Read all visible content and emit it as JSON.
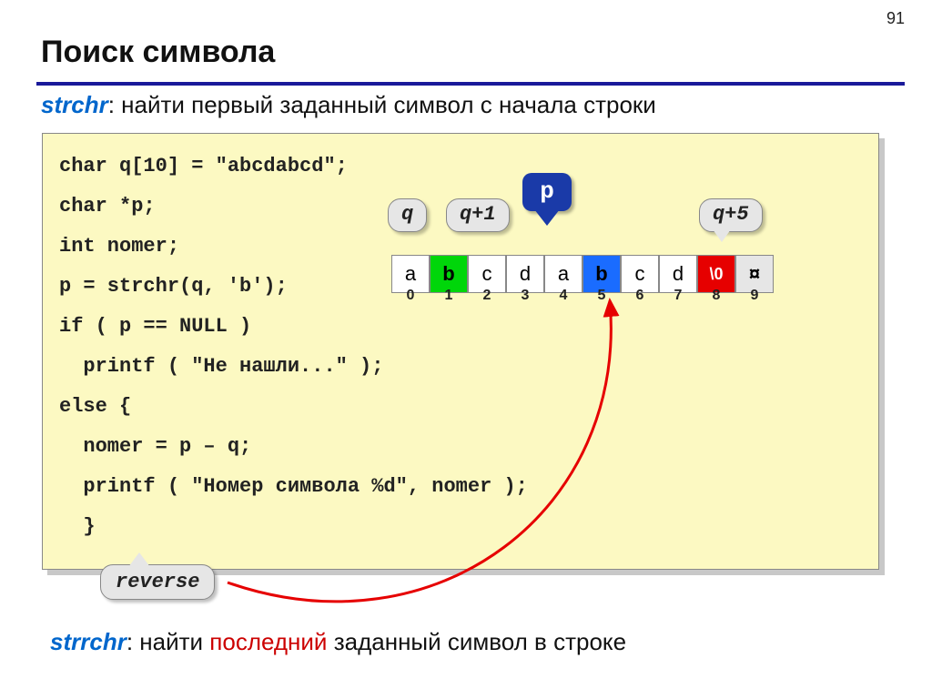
{
  "page_number": "91",
  "title": "Поиск символа",
  "subtitle": {
    "fn": "strchr",
    "rest": ": найти первый заданный символ c начала строки"
  },
  "code": {
    "l1": "char q[10] = \"abcdabcd\";",
    "l2": "char *p;",
    "l3": "int nomer;",
    "l4": "p = strchr(q, 'b');",
    "l5": "if ( p == NULL )",
    "l6": "  printf ( \"Не нашли...\" );",
    "l7": "else {",
    "l8": "  nomer = p – q;",
    "l9": "  printf ( \"Номер символа %d\", nomer );",
    "l10": "  }"
  },
  "callouts": {
    "q": "q",
    "q1": "q+1",
    "q5": "q+5",
    "p": "p",
    "reverse": "reverse"
  },
  "array": {
    "cells": [
      "a",
      "b",
      "c",
      "d",
      "a",
      "b",
      "c",
      "d",
      "\\0",
      "¤"
    ],
    "indices": [
      "0",
      "1",
      "2",
      "3",
      "4",
      "5",
      "6",
      "7",
      "8",
      "9"
    ]
  },
  "bottom": {
    "fn": "strrchr",
    "pre": ": найти ",
    "last": "последний",
    "post": " заданный символ в строке"
  }
}
